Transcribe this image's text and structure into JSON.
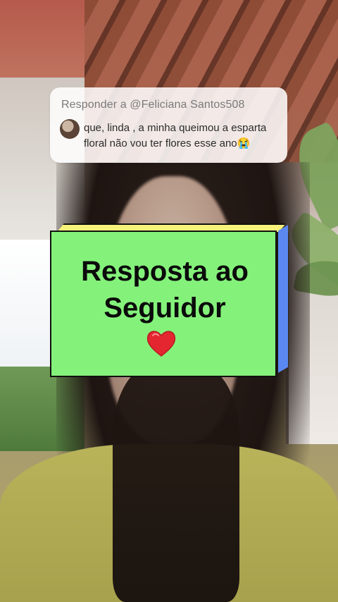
{
  "reply": {
    "header": "Responder a @Feliciana Santos508",
    "message": "que, linda , a minha queimou a esparta floral não vou ter flores esse ano😭"
  },
  "sticker": {
    "title": "Resposta ao\nSeguidor",
    "heart_color": "#e3262f"
  }
}
